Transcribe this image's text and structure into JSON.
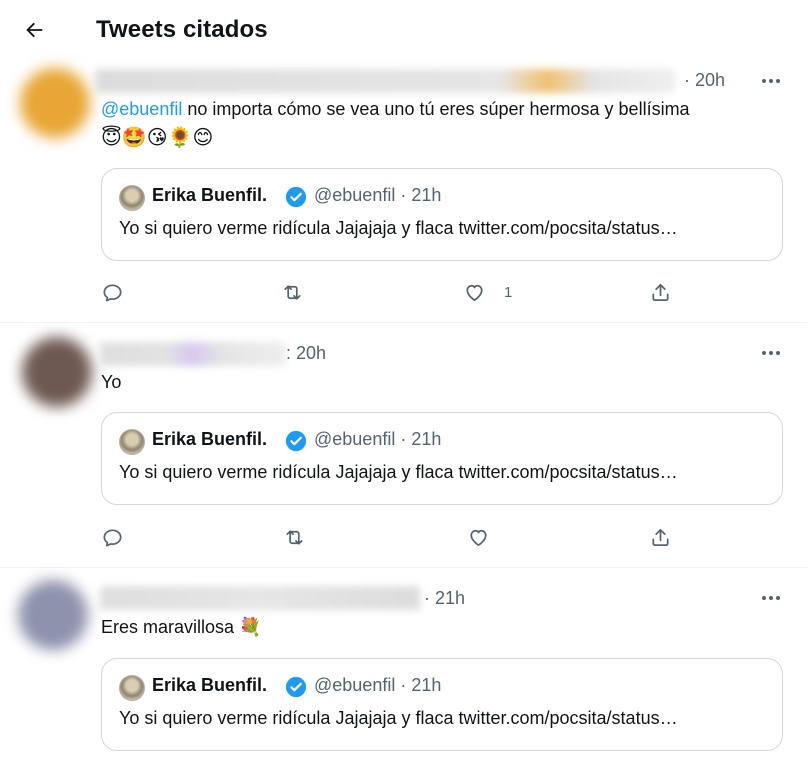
{
  "header": {
    "title": "Tweets citados",
    "back_icon": "arrow-left-icon"
  },
  "colors": {
    "accent": "#1d9bf0",
    "secondary_text": "#536471",
    "border": "#cfd9de"
  },
  "tweets": [
    {
      "time": "· 20h",
      "mention": "@ebuenfil",
      "text": " no importa cómo se vea uno tú eres súper hermosa y bellísima",
      "emojis": "😇🤩😘🌻😊",
      "quote": {
        "name": "Erika Buenfil.",
        "handle": "@ebuenfil · 21h",
        "text": "Yo si quiero verme ridícula Jajajaja y flaca twitter.com/pocsita/status…"
      },
      "like_count": "1"
    },
    {
      "time": ": 20h",
      "text": "Yo",
      "quote": {
        "name": "Erika Buenfil.",
        "handle": "@ebuenfil · 21h",
        "text": "Yo si quiero verme ridícula Jajajaja y flaca twitter.com/pocsita/status…"
      },
      "like_count": ""
    },
    {
      "time": "· 21h",
      "text": "Eres maravillosa 💐",
      "quote": {
        "name": "Erika Buenfil.",
        "handle": "@ebuenfil · 21h",
        "text": "Yo si quiero verme ridícula Jajajaja y flaca twitter.com/pocsita/status…"
      }
    }
  ]
}
